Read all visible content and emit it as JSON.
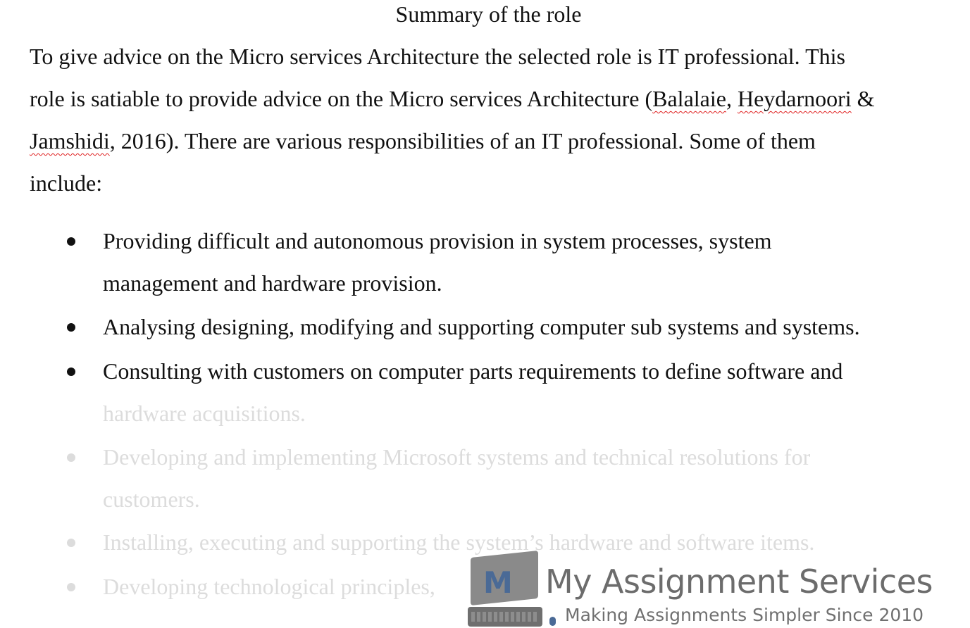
{
  "document": {
    "title": "Summary of the role",
    "intro_paragraph": {
      "lines": [
        [
          {
            "text": "To give advice on the Micro services Architecture the selected role is IT professional. This",
            "spell_error": false
          }
        ],
        [
          {
            "text": "role is satiable to provide advice on the Micro services Architecture (",
            "spell_error": false
          },
          {
            "text": "Balalaie",
            "spell_error": true
          },
          {
            "text": ", ",
            "spell_error": false
          },
          {
            "text": "Heydarnoori",
            "spell_error": true
          },
          {
            "text": " &",
            "spell_error": false
          }
        ],
        [
          {
            "text": "Jamshidi",
            "spell_error": true
          },
          {
            "text": ", 2016). There are various responsibilities of an IT professional. Some of them",
            "spell_error": false
          }
        ],
        [
          {
            "text": "include:",
            "spell_error": false
          }
        ]
      ]
    },
    "responsibilities": [
      {
        "lines": [
          "Providing difficult and autonomous provision in system processes, system",
          "management and hardware provision."
        ],
        "faded_lines": [
          false,
          false
        ]
      },
      {
        "lines": [
          "Analysing designing, modifying and supporting computer sub systems and systems."
        ],
        "faded_lines": [
          false
        ]
      },
      {
        "lines": [
          "Consulting with customers on computer parts requirements to define software and",
          "hardware acquisitions."
        ],
        "faded_lines": [
          false,
          true
        ]
      },
      {
        "lines": [
          "Developing and implementing Microsoft systems and technical resolutions for",
          "customers."
        ],
        "faded_lines": [
          true,
          true
        ]
      },
      {
        "lines": [
          "Installing, executing and supporting the system’s hardware and software items."
        ],
        "faded_lines": [
          true
        ]
      },
      {
        "lines": [
          "Developing technological principles,"
        ],
        "faded_lines": [
          true
        ]
      }
    ]
  },
  "watermark": {
    "logo_letter": "M",
    "brand_name": "My Assignment Services",
    "tagline": "Making Assignments Simpler Since 2010",
    "icons": [
      "laptop-icon",
      "keyboard-icon",
      "mouse-icon"
    ],
    "colors": {
      "brand_gray": "#6c6c6c",
      "brand_blue": "#4a6a96",
      "faded_text": "#dcdcdc",
      "spell_underline": "#e02020"
    }
  }
}
